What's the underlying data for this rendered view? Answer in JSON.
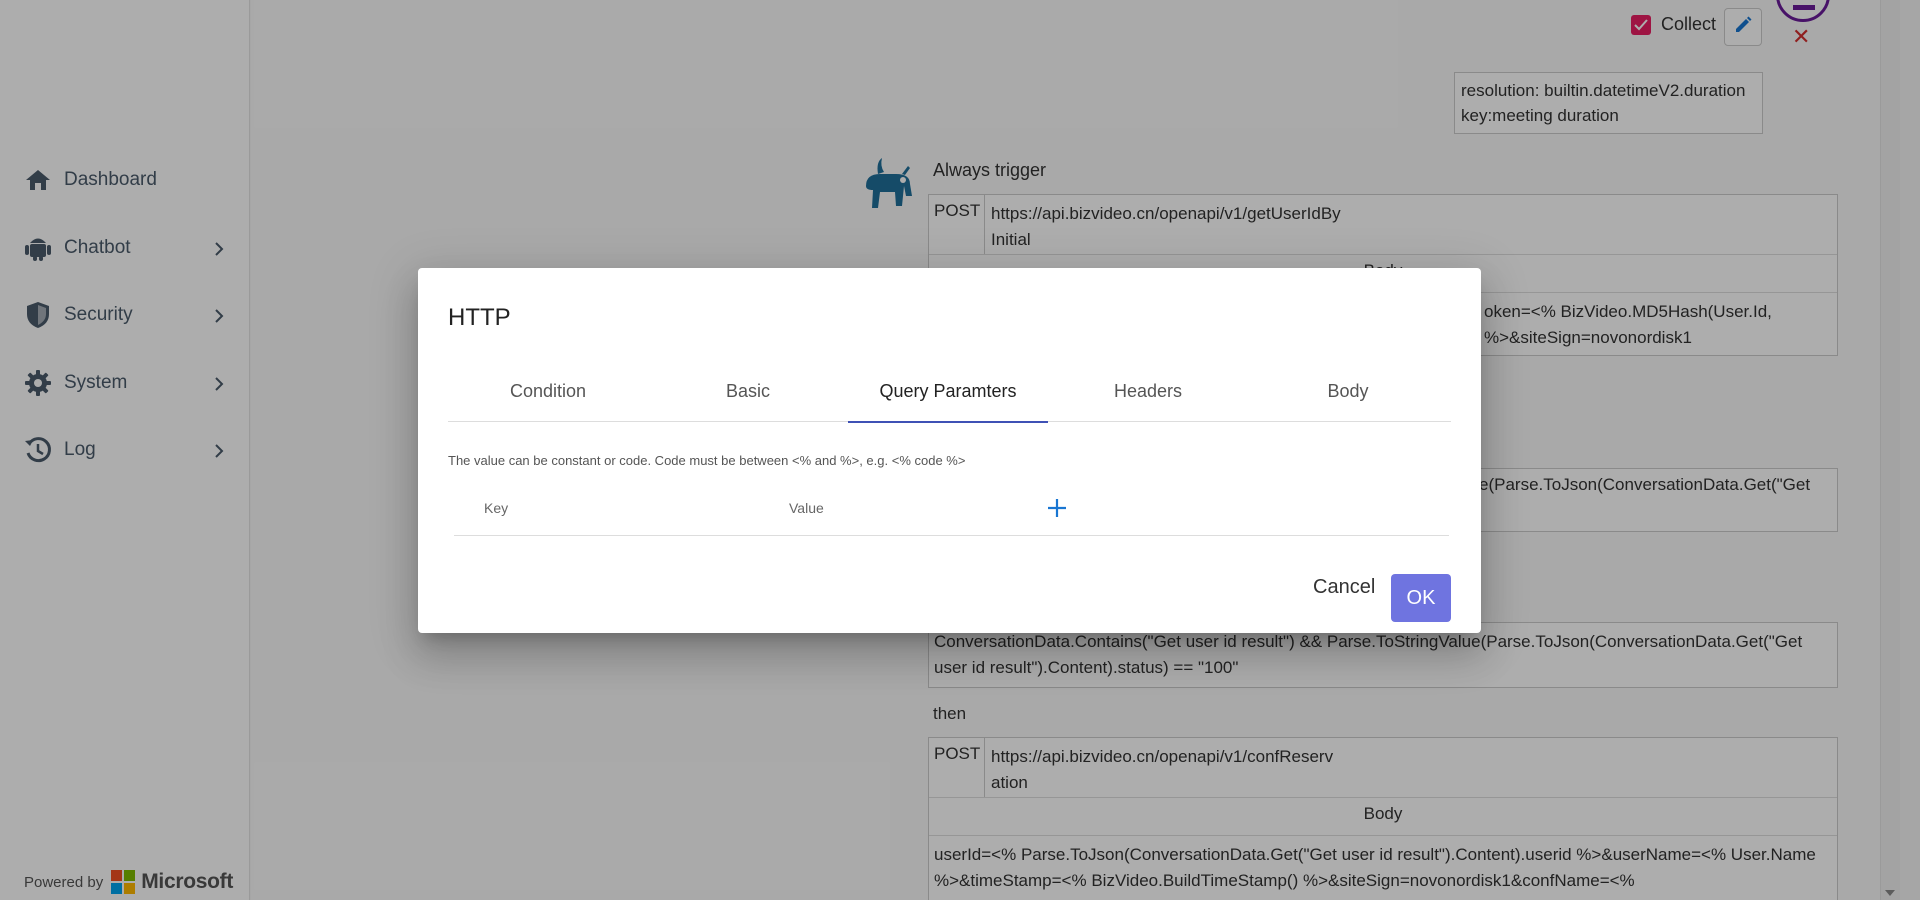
{
  "sidebar": {
    "items": [
      {
        "label": "Dashboard",
        "icon": "home-icon"
      },
      {
        "label": "Chatbot",
        "icon": "android-icon"
      },
      {
        "label": "Security",
        "icon": "shield-icon"
      },
      {
        "label": "System",
        "icon": "gear-icon"
      },
      {
        "label": "Log",
        "icon": "history-icon"
      }
    ],
    "powered_by": "Powered by",
    "brand": "Microsoft"
  },
  "background": {
    "collect_label": "Collect",
    "entity_lines": [
      "resolution: builtin.datetimeV2.duration",
      "key:meeting duration"
    ],
    "trigger_label": "Always trigger",
    "card1": {
      "method": "POST",
      "url": "https://api.bizvideo.cn/openapi/v1/getUserIdBy Initial",
      "body_header": "Body",
      "body_text": "oken=<% BizVideo.MD5Hash(User.Id, %>&siteSign=novonordisk1"
    },
    "card2_text": "e(Parse.ToJson(ConversationData.Get(\"Get",
    "condition_text": "ConversationData.Contains(\"Get user id result\") && Parse.ToStringValue(Parse.ToJson(ConversationData.Get(\"Get user id result\").Content).status) == \"100\"",
    "then_label": "then",
    "card3": {
      "method": "POST",
      "url": "https://api.bizvideo.cn/openapi/v1/confReserv ation",
      "body_header": "Body",
      "body_text": "userId=<% Parse.ToJson(ConversationData.Get(\"Get user id result\").Content).userid %>&userName=<% User.Name %>&timeStamp=<% BizVideo.BuildTimeStamp() %>&siteSign=novonordisk1&confName=<%"
    }
  },
  "dialog": {
    "title": "HTTP",
    "tabs": [
      "Condition",
      "Basic",
      "Query Paramters",
      "Headers",
      "Body"
    ],
    "active_tab": "Query Paramters",
    "hint": "The value can be constant or code. Code must be between <% and %>, e.g. <% code %>",
    "key_header": "Key",
    "value_header": "Value",
    "cancel_label": "Cancel",
    "ok_label": "OK"
  },
  "colors": {
    "accent": "#3f51b5",
    "ok_button": "#6f74e0",
    "checkbox": "#e91e63",
    "add_icon": "#1976d2"
  }
}
